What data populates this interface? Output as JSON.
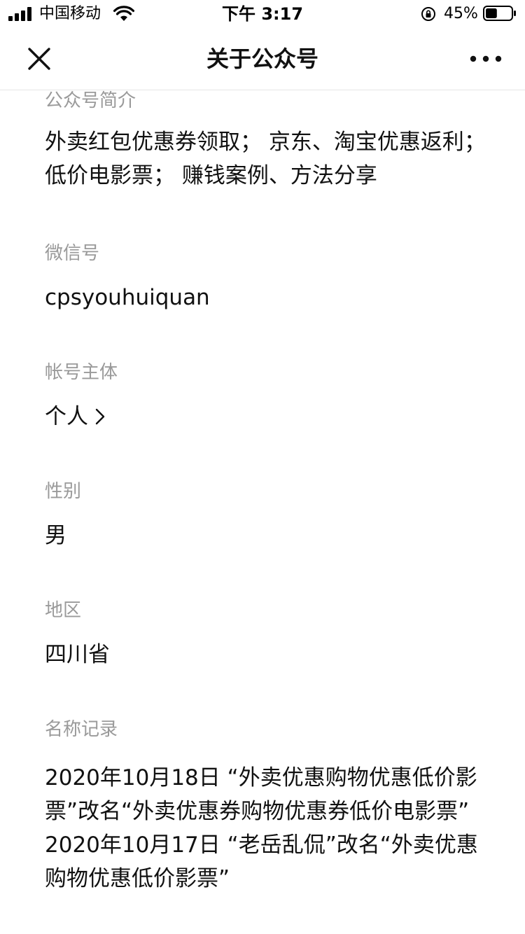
{
  "status_bar": {
    "carrier": "中国移动",
    "time": "下午 3:17",
    "battery_percent": "45%",
    "battery_level": 0.45
  },
  "nav": {
    "title": "关于公众号",
    "close_icon": "close-icon",
    "more_icon": "more-icon"
  },
  "sections": {
    "intro": {
      "label": "公众号简介",
      "value": "外卖红包优惠券领取； 京东、淘宝优惠返利； 低价电影票； 赚钱案例、方法分享"
    },
    "wechat_id": {
      "label": "微信号",
      "value": "cpsyouhuiquan"
    },
    "account_subject": {
      "label": "帐号主体",
      "value": "个人"
    },
    "gender": {
      "label": "性别",
      "value": "男"
    },
    "region": {
      "label": "地区",
      "value": "四川省"
    },
    "name_history": {
      "label": "名称记录",
      "entries": [
        "2020年10月18日 “外卖优惠购物优惠低价影票”改名“外卖优惠券购物优惠券低价电影票”",
        "2020年10月17日 “老岳乱侃”改名“外卖优惠购物优惠低价影票”"
      ]
    }
  },
  "colors": {
    "label": "#9a9a9a",
    "value": "#111111",
    "divider": "#e6e6e6"
  }
}
